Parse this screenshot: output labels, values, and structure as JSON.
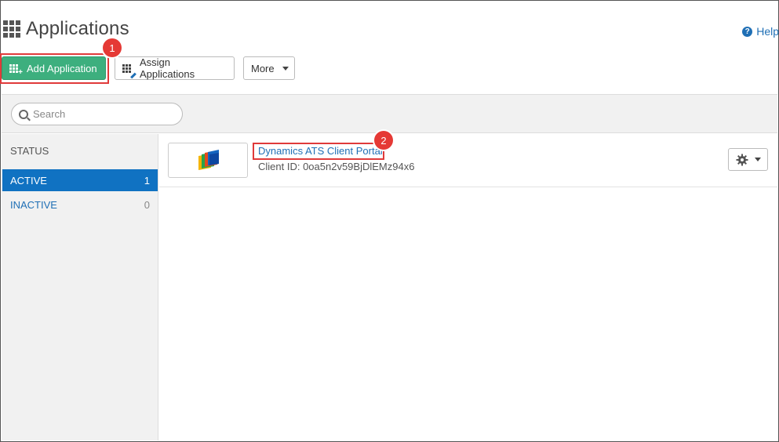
{
  "page": {
    "title": "Applications",
    "help_label": "Help"
  },
  "toolbar": {
    "add_label": "Add Application",
    "assign_label": "Assign Applications",
    "more_label": "More"
  },
  "search": {
    "placeholder": "Search"
  },
  "sidebar": {
    "status_heading": "STATUS",
    "items": [
      {
        "label": "ACTIVE",
        "count": "1"
      },
      {
        "label": "INACTIVE",
        "count": "0"
      }
    ]
  },
  "apps": [
    {
      "name": "Dynamics ATS Client Portal",
      "client_id": "Client ID: 0oa5n2v59BjDlEMz94x6"
    }
  ],
  "annotations": {
    "callout_1": "1",
    "callout_2": "2"
  },
  "colors": {
    "primary_button": "#3daf7e",
    "active_item": "#1072c2",
    "link": "#1f6fb5",
    "callout": "#e53935"
  }
}
